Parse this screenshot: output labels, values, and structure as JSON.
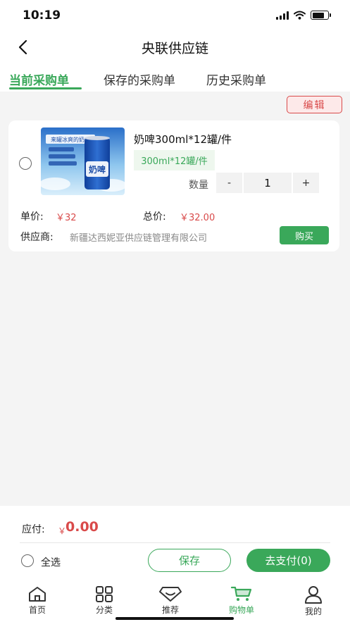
{
  "status_bar": {
    "time": "10:19"
  },
  "nav": {
    "title": "央联供应链"
  },
  "tabs": [
    {
      "label": "当前采购单",
      "active": true
    },
    {
      "label": "保存的采购单",
      "active": false
    },
    {
      "label": "历史采购单",
      "active": false
    }
  ],
  "edit_label": "编辑",
  "product": {
    "image_texts": [
      "来罐冰爽的奶啤",
      "奶啤"
    ],
    "name": "奶啤300ml*12罐/件",
    "spec": "300ml*12罐/件",
    "quantity_label": "数量",
    "minus": "-",
    "plus": "+",
    "quantity": "1",
    "unit_price_label": "单价:",
    "unit_price": "￥32",
    "total_label": "总价:",
    "total_price": "￥32.00",
    "supplier_label": "供应商:",
    "supplier": "新疆达西妮亚供应链管理有限公司",
    "buy_label": "购买"
  },
  "summary": {
    "pay_label": "应付:",
    "currency": "￥",
    "amount": "0.00",
    "select_all_label": "全选",
    "save_label": "保存",
    "pay_button_label": "去支付(0)"
  },
  "tabbar": [
    {
      "label": "首页",
      "icon": "home-icon",
      "active": false
    },
    {
      "label": "分类",
      "icon": "grid-icon",
      "active": false
    },
    {
      "label": "推荐",
      "icon": "recommend-icon",
      "active": false
    },
    {
      "label": "购物单",
      "icon": "cart-icon",
      "active": true
    },
    {
      "label": "我的",
      "icon": "user-icon",
      "active": false
    }
  ],
  "colors": {
    "accent": "#3aa85a",
    "price": "#d94a4a"
  }
}
